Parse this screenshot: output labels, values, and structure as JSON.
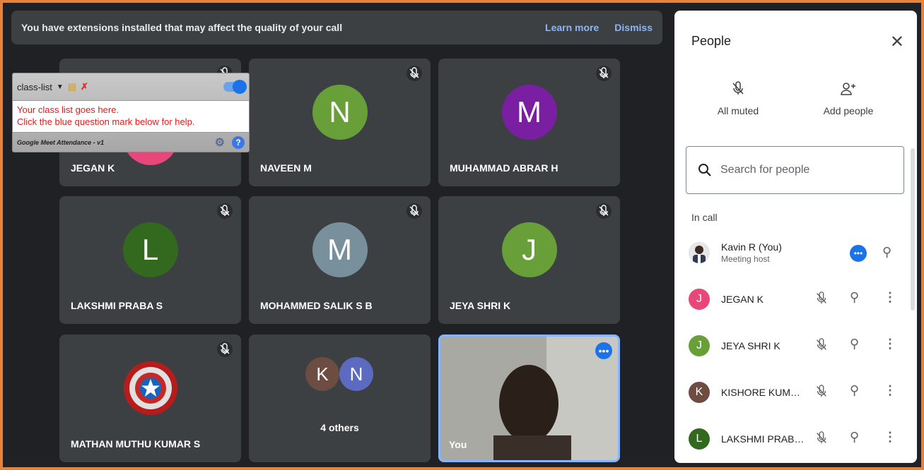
{
  "banner": {
    "message": "You have extensions installed that may affect the quality of your call",
    "learn_more": "Learn more",
    "dismiss": "Dismiss"
  },
  "tiles": [
    {
      "name": "JEGAN K",
      "initial": "",
      "color": "#e8477a"
    },
    {
      "name": "NAVEEN M",
      "initial": "N",
      "color": "#689f38"
    },
    {
      "name": "MUHAMMAD ABRAR H",
      "initial": "M",
      "color": "#7b1fa2"
    },
    {
      "name": "LAKSHMI PRABA S",
      "initial": "L",
      "color": "#33691e"
    },
    {
      "name": "MOHAMMED SALIK S B",
      "initial": "M",
      "color": "#78909c"
    },
    {
      "name": "JEYA SHRI K",
      "initial": "J",
      "color": "#689f38"
    },
    {
      "name": "MATHAN MUTHU KUMAR S",
      "initial": "",
      "color": "#c62828"
    },
    {
      "name": "4 others",
      "initial_a": "K",
      "initial_b": "N",
      "color_a": "#6d4c41",
      "color_b": "#5c6bc0"
    },
    {
      "name": "You"
    }
  ],
  "extension": {
    "dropdown": "class-list",
    "line1": "Your class list goes here.",
    "line2": "Click the blue question mark below for help.",
    "footer": "Google Meet Attendance - v1",
    "help": "?"
  },
  "panel": {
    "title": "People",
    "all_muted": "All muted",
    "add_people": "Add people",
    "search_placeholder": "Search for people",
    "section": "In call",
    "people": [
      {
        "name": "Kavin R (You)",
        "sub": "Meeting host",
        "initial": "",
        "color": "#ffffff"
      },
      {
        "name": "JEGAN K",
        "initial": "J",
        "color": "#e8477a"
      },
      {
        "name": "JEYA SHRI K",
        "initial": "J",
        "color": "#689f38"
      },
      {
        "name": "KISHORE KUMAR ...",
        "initial": "K",
        "color": "#6d4c41"
      },
      {
        "name": "LAKSHMI PRABA S",
        "initial": "L",
        "color": "#33691e"
      }
    ]
  }
}
